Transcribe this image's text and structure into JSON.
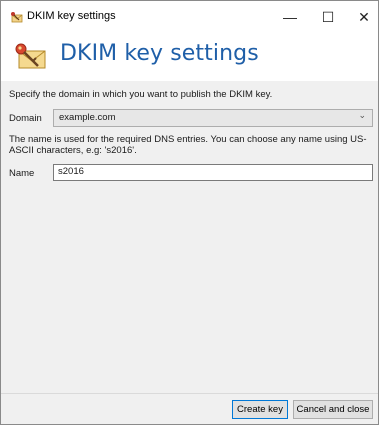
{
  "window": {
    "title": "DKIM key settings",
    "controls": {
      "minimize": "—",
      "maximize": "☐",
      "close": "✕"
    }
  },
  "header": {
    "heading": "DKIM key settings",
    "icon": "key-envelope-icon"
  },
  "form": {
    "instruction": "Specify the domain in which you want to publish the DKIM key.",
    "domain_label": "Domain",
    "domain_value": "example.com",
    "name_help": "The name is used for the required DNS entries. You can choose any name using US-ASCII characters, e.g: 's2016'.",
    "name_label": "Name",
    "name_value": "s2016"
  },
  "footer": {
    "create_label": "Create key",
    "cancel_label": "Cancel and close"
  },
  "colors": {
    "heading": "#1f5fa8",
    "focus_border": "#0078d7"
  }
}
